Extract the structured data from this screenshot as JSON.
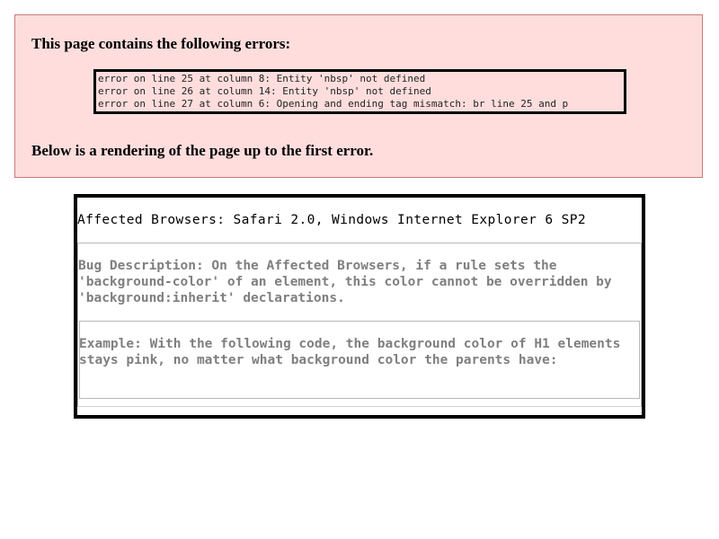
{
  "parser_error": {
    "heading": "This page contains the following errors:",
    "errors": [
      "error on line 25 at column 8: Entity 'nbsp' not defined",
      "error on line 26 at column 14: Entity 'nbsp' not defined",
      "error on line 27 at column 6: Opening and ending tag mismatch: br line 25 and p"
    ],
    "render_note": "Below is a rendering of the page up to the first error."
  },
  "content": {
    "affected_browsers": "Affected Browsers: Safari 2.0, Windows Internet Explorer 6 SP2",
    "bug_description": "Bug Description: On the Affected Browsers, if a rule sets the 'background-color' of an element, this color cannot be overridden by 'background:inherit' declarations.",
    "example": "Example: With the following code, the background color of H1 elements stays pink, no matter what background color the parents have:"
  },
  "colors": {
    "error_background": "#ffdddd",
    "error_border": "#c97a7a",
    "muted_text": "#7f7f7f"
  }
}
